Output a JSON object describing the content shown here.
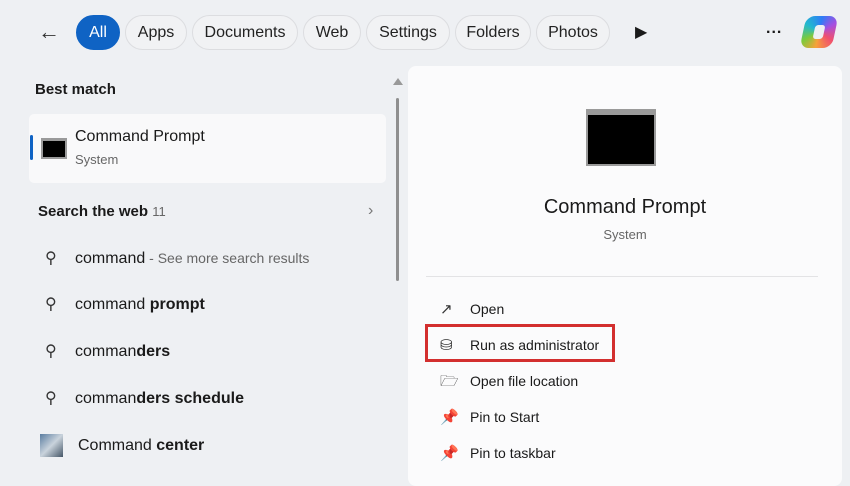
{
  "tabs": [
    "All",
    "Apps",
    "Documents",
    "Web",
    "Settings",
    "Folders",
    "Photos"
  ],
  "more_label": "...",
  "best_match": {
    "heading": "Best match",
    "title": "Command Prompt",
    "subtitle": "System"
  },
  "web": {
    "heading": "Search the web",
    "count": "11",
    "items": [
      {
        "normal": "command",
        "bold": "",
        "suffix": " - See more search results"
      },
      {
        "normal": "command ",
        "bold": "prompt"
      },
      {
        "normal": "comman",
        "bold": "ders"
      },
      {
        "normal": "comman",
        "bold": "ders schedule"
      },
      {
        "normal": "Command ",
        "bold": "center"
      }
    ]
  },
  "details": {
    "title": "Command Prompt",
    "subtitle": "System",
    "actions": [
      "Open",
      "Run as administrator",
      "Open file location",
      "Pin to Start",
      "Pin to taskbar"
    ]
  },
  "colors": {
    "accent": "#0f63c4",
    "highlight": "#d32f2f"
  }
}
